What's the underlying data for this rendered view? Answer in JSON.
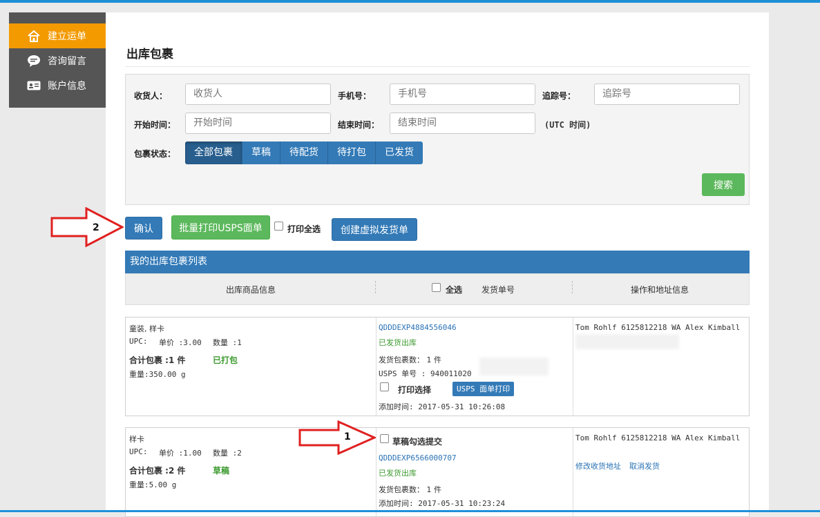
{
  "sidebar": {
    "items": [
      {
        "label": "建立运单",
        "icon": "home-icon",
        "active": true
      },
      {
        "label": "咨询留言",
        "icon": "chat-icon",
        "active": false
      },
      {
        "label": "账户信息",
        "icon": "id-card-icon",
        "active": false
      }
    ]
  },
  "page": {
    "title": "出库包裹"
  },
  "filter": {
    "receiver": {
      "label": "收货人：",
      "placeholder": "收货人"
    },
    "phone": {
      "label": "手机号：",
      "placeholder": "手机号"
    },
    "tracking": {
      "label": "追踪号：",
      "placeholder": "追踪号"
    },
    "start": {
      "label": "开始时间：",
      "placeholder": "开始时间"
    },
    "end": {
      "label": "结束时间：",
      "placeholder": "结束时间"
    },
    "utc_note": "(UTC 时间)",
    "status_label": "包裹状态：",
    "status_tabs": [
      "全部包裹",
      "草稿",
      "待配货",
      "待打包",
      "已发货"
    ],
    "search_label": "搜索"
  },
  "actions": {
    "confirm": "确认",
    "batch_print": "批量打印USPS面单",
    "print_all": "打印全选",
    "create_virtual": "创建虚拟发货单"
  },
  "list": {
    "title": "我的出库包裹列表",
    "col_goods": "出库商品信息",
    "col_select_all": "全选",
    "col_shipno": "发货单号",
    "col_ops": "操作和地址信息"
  },
  "orders": [
    {
      "goods": "童装, 样卡",
      "upc": "UPC:",
      "price": "单价 :3.00",
      "qty": "数量 :1",
      "total": "合计包裹 :1 件",
      "status_tag": "已打包",
      "weight": "重量:350.00 g",
      "shipno": "QDDDEXP4884556046",
      "ship_status": "已发货出库",
      "pkg_count": "发货包裹数： 1 件",
      "usps": "USPS 单号 : 940011020",
      "print_select": "打印选择",
      "usps_print_btn": "USPS 面单打印",
      "added": "添加时间: 2017-05-31 10:26:08",
      "address": "Tom Rohlf 6125812218 WA Alex Kimball"
    },
    {
      "goods": "样卡",
      "upc": "UPC:",
      "price": "单价 :1.00",
      "qty": "数量 :2",
      "total": "合计包裹 :2 件",
      "status_tag": "草稿",
      "weight": "重量:5.00 g",
      "draft_check": "草稿勾选提交",
      "shipno": "QDDDEXP6566000707",
      "ship_status": "已发货出库",
      "pkg_count": "发货包裹数： 1 件",
      "added": "添加时间: 2017-05-31 10:23:24",
      "address": "Tom Rohlf 6125812218 WA Alex Kimball",
      "edit_address": "修改收货地址",
      "cancel_ship": "取消发货"
    }
  ],
  "annotations": {
    "arrow1": "1",
    "arrow2": "2"
  }
}
